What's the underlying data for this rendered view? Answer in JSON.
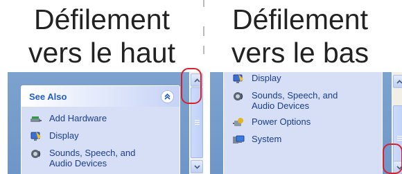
{
  "headings": {
    "scroll_up": [
      "Défilement",
      "vers le haut"
    ],
    "scroll_down": [
      "Défilement",
      "vers le bas"
    ]
  },
  "left_panel": {
    "box_title": "See Also",
    "collapse_glyph": "⌃⌃",
    "items": [
      {
        "label": "Add Hardware",
        "icon": "add-hardware-icon"
      },
      {
        "label": "Display",
        "icon": "display-icon"
      },
      {
        "label": "Sounds, Speech, and Audio Devices",
        "icon": "sounds-speech-icon"
      }
    ],
    "scroll_position": 0.0
  },
  "right_panel": {
    "items": [
      {
        "label": "Display",
        "icon": "display-icon"
      },
      {
        "label": "Sounds, Speech, and Audio Devices",
        "icon": "sounds-speech-icon"
      },
      {
        "label": "Power Options",
        "icon": "power-options-icon"
      },
      {
        "label": "System",
        "icon": "system-icon"
      }
    ],
    "scroll_position": 1.0
  },
  "colors": {
    "highlight": "#d9202b",
    "panel_background": "#7da2ce",
    "link_text": "#1c3c8c",
    "box_title": "#215dc6"
  }
}
